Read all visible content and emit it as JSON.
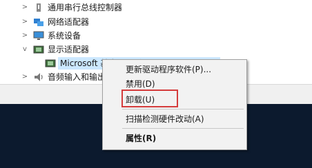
{
  "tree": {
    "items": [
      {
        "label": "通用串行总线控制器",
        "chevron": ">",
        "icon": "usb-icon"
      },
      {
        "label": "网络适配器",
        "chevron": ">",
        "icon": "network-adapter-icon"
      },
      {
        "label": "系统设备",
        "chevron": ">",
        "icon": "monitor-icon"
      },
      {
        "label": "显示适配器",
        "chevron": "v",
        "icon": "display-adapter-icon"
      },
      {
        "label": "Microsoft 基本显示适配器",
        "chevron": "",
        "icon": "display-adapter-icon"
      },
      {
        "label": "音频输入和输出",
        "chevron": ">",
        "icon": "speaker-icon"
      }
    ]
  },
  "context_menu": {
    "items": [
      {
        "label": "更新驱动程序软件(P)..."
      },
      {
        "label": "禁用(D)"
      },
      {
        "label": "卸载(U)"
      },
      {
        "label": "扫描检测硬件改动(A)"
      },
      {
        "label": "属性(R)"
      }
    ]
  },
  "colors": {
    "selection": "#cce8ff",
    "highlight_border": "#d43b3b",
    "desktop": "#0c1a2e"
  }
}
